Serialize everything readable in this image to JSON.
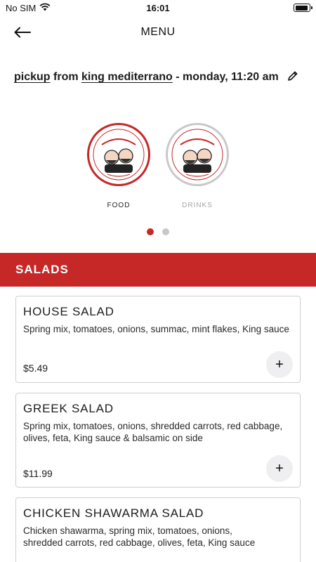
{
  "status_bar": {
    "carrier": "No SIM",
    "time": "16:01",
    "wifi_icon": "wifi-icon",
    "battery_icon": "battery-icon",
    "battery_level": 0.9
  },
  "nav": {
    "title": "MENU",
    "back_icon": "arrow-left-icon"
  },
  "order": {
    "method": "pickup",
    "from_text": " from ",
    "location": "king mediterrano",
    "time_text": " - monday, 11:20 am",
    "edit_icon": "pencil-icon"
  },
  "categories": [
    {
      "label": "FOOD",
      "active": true,
      "logo_icon": "king-mediterrano-logo"
    },
    {
      "label": "DRINKS",
      "active": false,
      "logo_icon": "king-mediterrano-logo"
    }
  ],
  "pager": {
    "pages": 2,
    "current": 1
  },
  "section": {
    "title": "SALADS"
  },
  "items": [
    {
      "name": "HOUSE SALAD",
      "description": "Spring mix, tomatoes, onions, summac, mint flakes, King sauce",
      "price": "$5.49",
      "add_label": "+"
    },
    {
      "name": "GREEK SALAD",
      "description": "Spring mix, tomatoes, onions, shredded carrots, red cabbage, olives, feta, King sauce & balsamic on side",
      "price": "$11.99",
      "add_label": "+"
    },
    {
      "name": "CHICKEN SHAWARMA SALAD",
      "description_line1": "Chicken shawarma, spring mix, tomatoes, onions,",
      "description_line2": "shredded carrots, red cabbage, olives, feta, King sauce",
      "add_label": "+"
    }
  ],
  "colors": {
    "brand_red": "#c62828",
    "inactive_border": "#c9c9c9",
    "add_button_bg": "#efeff2"
  }
}
